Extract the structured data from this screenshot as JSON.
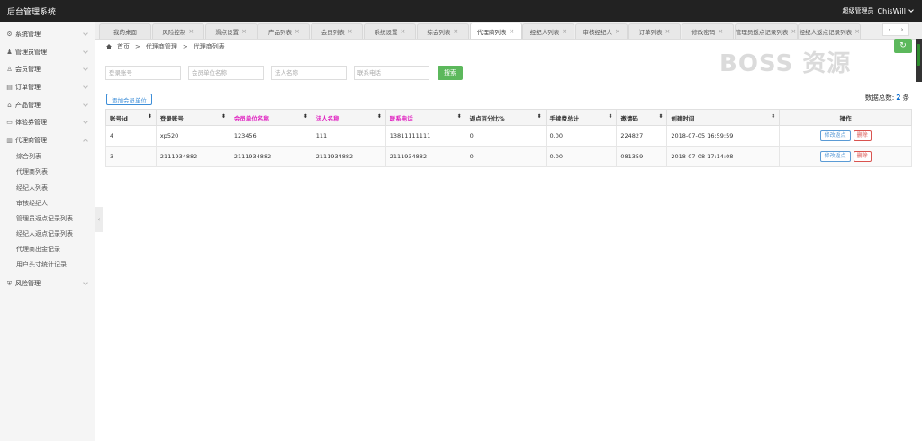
{
  "app": {
    "title": "后台管理系统"
  },
  "user": {
    "role": "超级管理员",
    "name": "ChisWill"
  },
  "sidebar": {
    "menus": [
      {
        "label": "系统管理",
        "icon": "gear-icon",
        "glyph": "⚙"
      },
      {
        "label": "管理员管理",
        "icon": "user-group-icon",
        "glyph": "♟"
      },
      {
        "label": "会员管理",
        "icon": "user-icon",
        "glyph": "♙"
      },
      {
        "label": "订单管理",
        "icon": "order-icon",
        "glyph": "▤"
      },
      {
        "label": "产品管理",
        "icon": "product-icon",
        "glyph": "⌂"
      },
      {
        "label": "体验券管理",
        "icon": "ticket-icon",
        "glyph": "▭"
      },
      {
        "label": "代理商管理",
        "icon": "agent-icon",
        "glyph": "▥"
      }
    ],
    "sub_items": [
      "综合列表",
      "代理商列表",
      "经纪人列表",
      "审核经纪人",
      "管理员返点记录列表",
      "经纪人返点记录列表",
      "代理商出金记录",
      "用户头寸统计记录"
    ],
    "last_menu": {
      "label": "风险管理",
      "icon": "shield-icon",
      "glyph": "⛨"
    }
  },
  "tabs": [
    {
      "label": "我的桌面",
      "active": false
    },
    {
      "label": "风险控制",
      "active": false
    },
    {
      "label": "滑点设置",
      "active": false
    },
    {
      "label": "产品列表",
      "active": false
    },
    {
      "label": "会员列表",
      "active": false
    },
    {
      "label": "系统设置",
      "active": false
    },
    {
      "label": "综会列表",
      "active": false
    },
    {
      "label": "代理商列表",
      "active": true
    },
    {
      "label": "经纪人列表",
      "active": false
    },
    {
      "label": "审核经纪人",
      "active": false
    },
    {
      "label": "订单列表",
      "active": false
    },
    {
      "label": "修改密码",
      "active": false
    },
    {
      "label": "管理员返点记录列表",
      "active": false
    },
    {
      "label": "经纪人返点记录列表",
      "active": false
    }
  ],
  "breadcrumb": {
    "home": "首页",
    "sep": ">",
    "level1": "代理商管理",
    "level2": "代理商列表"
  },
  "watermark": "BOSS 资源",
  "search": {
    "account_placeholder": "登录账号",
    "company_placeholder": "会员单位名称",
    "legal_placeholder": "法人名称",
    "phone_placeholder": "联系电话",
    "button": "搜索"
  },
  "add_button": "添加会员单位",
  "total": {
    "label": "数据总数:",
    "count": "2",
    "unit": "条"
  },
  "table": {
    "headers": [
      "账号id",
      "登录账号",
      "会员单位名称",
      "法人名称",
      "联系电话",
      "返点百分比%",
      "手续费总计",
      "邀请码",
      "创建时间",
      "操作"
    ],
    "rows": [
      [
        "4",
        "xp520",
        "123456",
        "111",
        "13811111111",
        "0",
        "0.00",
        "224827",
        "2018-07-05 16:59:59"
      ],
      [
        "3",
        "2111934882",
        "2111934882",
        "2111934882",
        "2111934882",
        "0",
        "0.00",
        "081359",
        "2018-07-08 17:14:08"
      ]
    ],
    "edit_label": "修改返点",
    "delete_label": "删除"
  }
}
